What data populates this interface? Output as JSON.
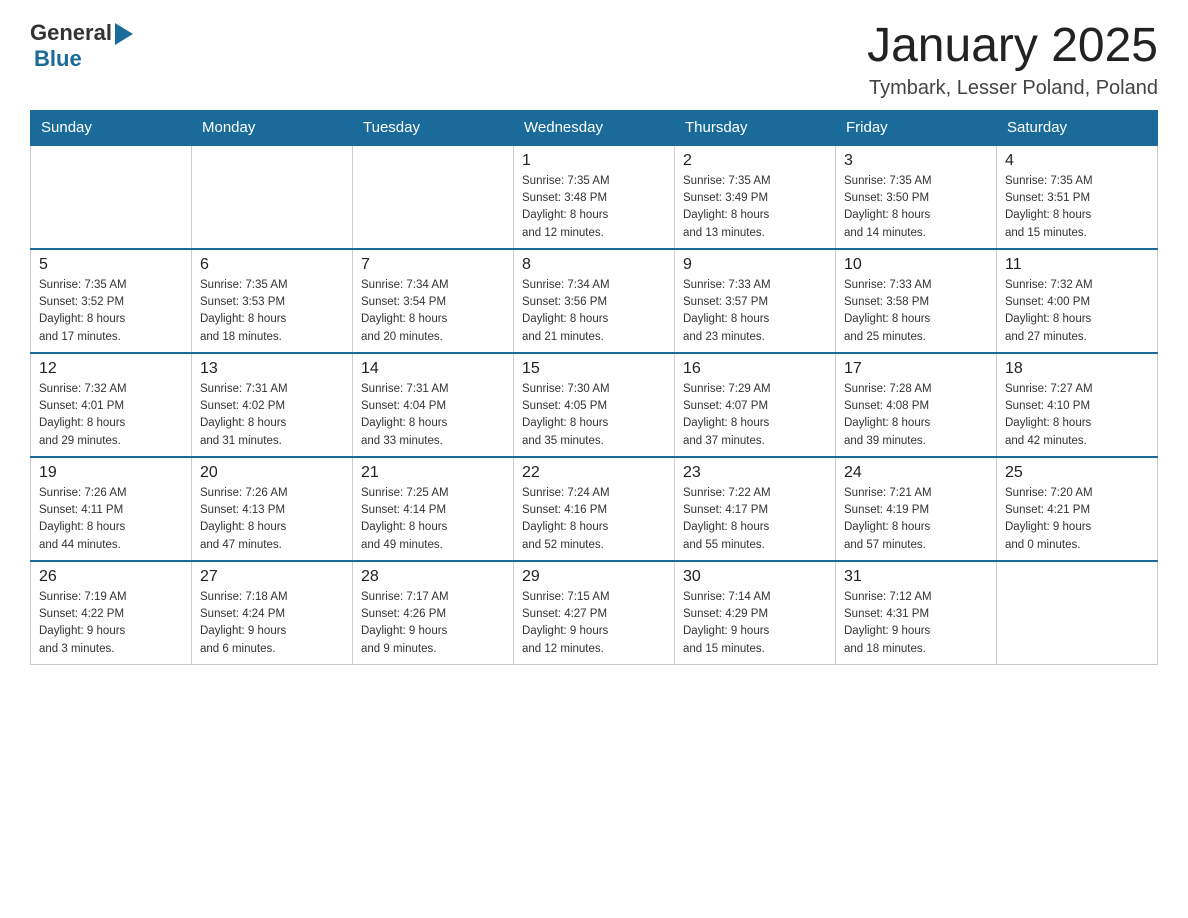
{
  "header": {
    "logo": {
      "general": "General",
      "blue": "Blue",
      "arrow_symbol": "▶"
    },
    "title": "January 2025",
    "subtitle": "Tymbark, Lesser Poland, Poland"
  },
  "calendar": {
    "days_of_week": [
      "Sunday",
      "Monday",
      "Tuesday",
      "Wednesday",
      "Thursday",
      "Friday",
      "Saturday"
    ],
    "weeks": [
      [
        {
          "day": "",
          "info": ""
        },
        {
          "day": "",
          "info": ""
        },
        {
          "day": "",
          "info": ""
        },
        {
          "day": "1",
          "info": "Sunrise: 7:35 AM\nSunset: 3:48 PM\nDaylight: 8 hours\nand 12 minutes."
        },
        {
          "day": "2",
          "info": "Sunrise: 7:35 AM\nSunset: 3:49 PM\nDaylight: 8 hours\nand 13 minutes."
        },
        {
          "day": "3",
          "info": "Sunrise: 7:35 AM\nSunset: 3:50 PM\nDaylight: 8 hours\nand 14 minutes."
        },
        {
          "day": "4",
          "info": "Sunrise: 7:35 AM\nSunset: 3:51 PM\nDaylight: 8 hours\nand 15 minutes."
        }
      ],
      [
        {
          "day": "5",
          "info": "Sunrise: 7:35 AM\nSunset: 3:52 PM\nDaylight: 8 hours\nand 17 minutes."
        },
        {
          "day": "6",
          "info": "Sunrise: 7:35 AM\nSunset: 3:53 PM\nDaylight: 8 hours\nand 18 minutes."
        },
        {
          "day": "7",
          "info": "Sunrise: 7:34 AM\nSunset: 3:54 PM\nDaylight: 8 hours\nand 20 minutes."
        },
        {
          "day": "8",
          "info": "Sunrise: 7:34 AM\nSunset: 3:56 PM\nDaylight: 8 hours\nand 21 minutes."
        },
        {
          "day": "9",
          "info": "Sunrise: 7:33 AM\nSunset: 3:57 PM\nDaylight: 8 hours\nand 23 minutes."
        },
        {
          "day": "10",
          "info": "Sunrise: 7:33 AM\nSunset: 3:58 PM\nDaylight: 8 hours\nand 25 minutes."
        },
        {
          "day": "11",
          "info": "Sunrise: 7:32 AM\nSunset: 4:00 PM\nDaylight: 8 hours\nand 27 minutes."
        }
      ],
      [
        {
          "day": "12",
          "info": "Sunrise: 7:32 AM\nSunset: 4:01 PM\nDaylight: 8 hours\nand 29 minutes."
        },
        {
          "day": "13",
          "info": "Sunrise: 7:31 AM\nSunset: 4:02 PM\nDaylight: 8 hours\nand 31 minutes."
        },
        {
          "day": "14",
          "info": "Sunrise: 7:31 AM\nSunset: 4:04 PM\nDaylight: 8 hours\nand 33 minutes."
        },
        {
          "day": "15",
          "info": "Sunrise: 7:30 AM\nSunset: 4:05 PM\nDaylight: 8 hours\nand 35 minutes."
        },
        {
          "day": "16",
          "info": "Sunrise: 7:29 AM\nSunset: 4:07 PM\nDaylight: 8 hours\nand 37 minutes."
        },
        {
          "day": "17",
          "info": "Sunrise: 7:28 AM\nSunset: 4:08 PM\nDaylight: 8 hours\nand 39 minutes."
        },
        {
          "day": "18",
          "info": "Sunrise: 7:27 AM\nSunset: 4:10 PM\nDaylight: 8 hours\nand 42 minutes."
        }
      ],
      [
        {
          "day": "19",
          "info": "Sunrise: 7:26 AM\nSunset: 4:11 PM\nDaylight: 8 hours\nand 44 minutes."
        },
        {
          "day": "20",
          "info": "Sunrise: 7:26 AM\nSunset: 4:13 PM\nDaylight: 8 hours\nand 47 minutes."
        },
        {
          "day": "21",
          "info": "Sunrise: 7:25 AM\nSunset: 4:14 PM\nDaylight: 8 hours\nand 49 minutes."
        },
        {
          "day": "22",
          "info": "Sunrise: 7:24 AM\nSunset: 4:16 PM\nDaylight: 8 hours\nand 52 minutes."
        },
        {
          "day": "23",
          "info": "Sunrise: 7:22 AM\nSunset: 4:17 PM\nDaylight: 8 hours\nand 55 minutes."
        },
        {
          "day": "24",
          "info": "Sunrise: 7:21 AM\nSunset: 4:19 PM\nDaylight: 8 hours\nand 57 minutes."
        },
        {
          "day": "25",
          "info": "Sunrise: 7:20 AM\nSunset: 4:21 PM\nDaylight: 9 hours\nand 0 minutes."
        }
      ],
      [
        {
          "day": "26",
          "info": "Sunrise: 7:19 AM\nSunset: 4:22 PM\nDaylight: 9 hours\nand 3 minutes."
        },
        {
          "day": "27",
          "info": "Sunrise: 7:18 AM\nSunset: 4:24 PM\nDaylight: 9 hours\nand 6 minutes."
        },
        {
          "day": "28",
          "info": "Sunrise: 7:17 AM\nSunset: 4:26 PM\nDaylight: 9 hours\nand 9 minutes."
        },
        {
          "day": "29",
          "info": "Sunrise: 7:15 AM\nSunset: 4:27 PM\nDaylight: 9 hours\nand 12 minutes."
        },
        {
          "day": "30",
          "info": "Sunrise: 7:14 AM\nSunset: 4:29 PM\nDaylight: 9 hours\nand 15 minutes."
        },
        {
          "day": "31",
          "info": "Sunrise: 7:12 AM\nSunset: 4:31 PM\nDaylight: 9 hours\nand 18 minutes."
        },
        {
          "day": "",
          "info": ""
        }
      ]
    ]
  }
}
